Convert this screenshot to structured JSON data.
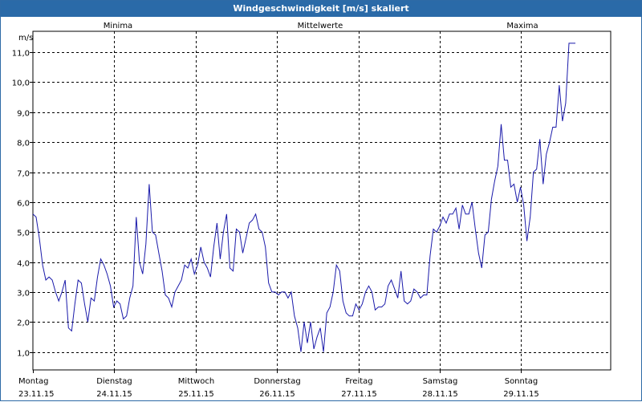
{
  "window": {
    "title": "Windgeschwindigkeit [m/s] skaliert"
  },
  "legend": {
    "min_label": "Minima",
    "min_color": "#22aa22",
    "mean_label": "Mittelwerte",
    "mean_color": "#2222cc",
    "max_label": "Maxima",
    "max_color": "#bb2222"
  },
  "chart_data": {
    "type": "line",
    "ylabel": "m/s",
    "ylim": [
      0.4,
      11.7
    ],
    "yticks": [
      "1,0",
      "2,0",
      "3,0",
      "4,0",
      "5,0",
      "6,0",
      "7,0",
      "8,0",
      "9,0",
      "10,0",
      "11,0"
    ],
    "ytick_values": [
      1,
      2,
      3,
      4,
      5,
      6,
      7,
      8,
      9,
      10,
      11
    ],
    "xlim": [
      0,
      7.1
    ],
    "xticks": [
      {
        "day": "Montag",
        "date": "23.11.15"
      },
      {
        "day": "Dienstag",
        "date": "24.11.15"
      },
      {
        "day": "Mittwoch",
        "date": "25.11.15"
      },
      {
        "day": "Donnerstag",
        "date": "26.11.15"
      },
      {
        "day": "Freitag",
        "date": "27.11.15"
      },
      {
        "day": "Samstag",
        "date": "28.11.15"
      },
      {
        "day": "Sonntag",
        "date": "29.11.15"
      }
    ],
    "grid": true,
    "series": [
      {
        "name": "Mittelwerte",
        "color": "#1a1aaa",
        "values": [
          5.6,
          5.5,
          4.8,
          3.9,
          3.4,
          3.5,
          3.4,
          3.0,
          2.7,
          3.0,
          3.4,
          1.8,
          1.7,
          2.6,
          3.4,
          3.3,
          2.6,
          2.0,
          2.8,
          2.7,
          3.5,
          4.1,
          3.9,
          3.6,
          3.2,
          2.5,
          2.7,
          2.6,
          2.1,
          2.2,
          2.8,
          3.2,
          5.5,
          4.0,
          3.6,
          4.6,
          6.6,
          5.0,
          4.9,
          4.3,
          3.7,
          2.9,
          2.8,
          2.5,
          3.0,
          3.2,
          3.4,
          3.9,
          3.8,
          4.1,
          3.6,
          3.9,
          4.5,
          4.0,
          3.8,
          3.5,
          4.5,
          5.3,
          4.1,
          5.0,
          5.6,
          3.8,
          3.7,
          5.1,
          5.0,
          4.3,
          4.8,
          5.3,
          5.4,
          5.6,
          5.1,
          5.0,
          4.5,
          3.3,
          3.0,
          3.0,
          2.9,
          3.0,
          3.0,
          2.8,
          3.0,
          2.2,
          1.8,
          1.0,
          2.0,
          1.3,
          2.0,
          1.1,
          1.5,
          1.8,
          1.0,
          2.3,
          2.5,
          3.0,
          3.9,
          3.7,
          2.7,
          2.3,
          2.2,
          2.2,
          2.6,
          2.4,
          2.6,
          3.0,
          3.2,
          3.0,
          2.4,
          2.5,
          2.5,
          2.6,
          3.2,
          3.4,
          3.1,
          2.8,
          3.7,
          2.7,
          2.6,
          2.7,
          3.1,
          3.0,
          2.8,
          2.9,
          2.9,
          4.2,
          5.1,
          5.0,
          5.2,
          5.5,
          5.3,
          5.6,
          5.6,
          5.8,
          5.1,
          5.9,
          5.6,
          5.6,
          6.0,
          5.1,
          4.3,
          3.8,
          4.9,
          5.0,
          6.1,
          6.7,
          7.2,
          8.6,
          7.4,
          7.4,
          6.5,
          6.6,
          6.0,
          6.5,
          5.9,
          4.7,
          5.5,
          7.0,
          7.1,
          8.1,
          6.6,
          7.6,
          8.0,
          8.5,
          8.5,
          9.9,
          8.7,
          9.3,
          11.3,
          11.3,
          11.3
        ]
      }
    ]
  }
}
